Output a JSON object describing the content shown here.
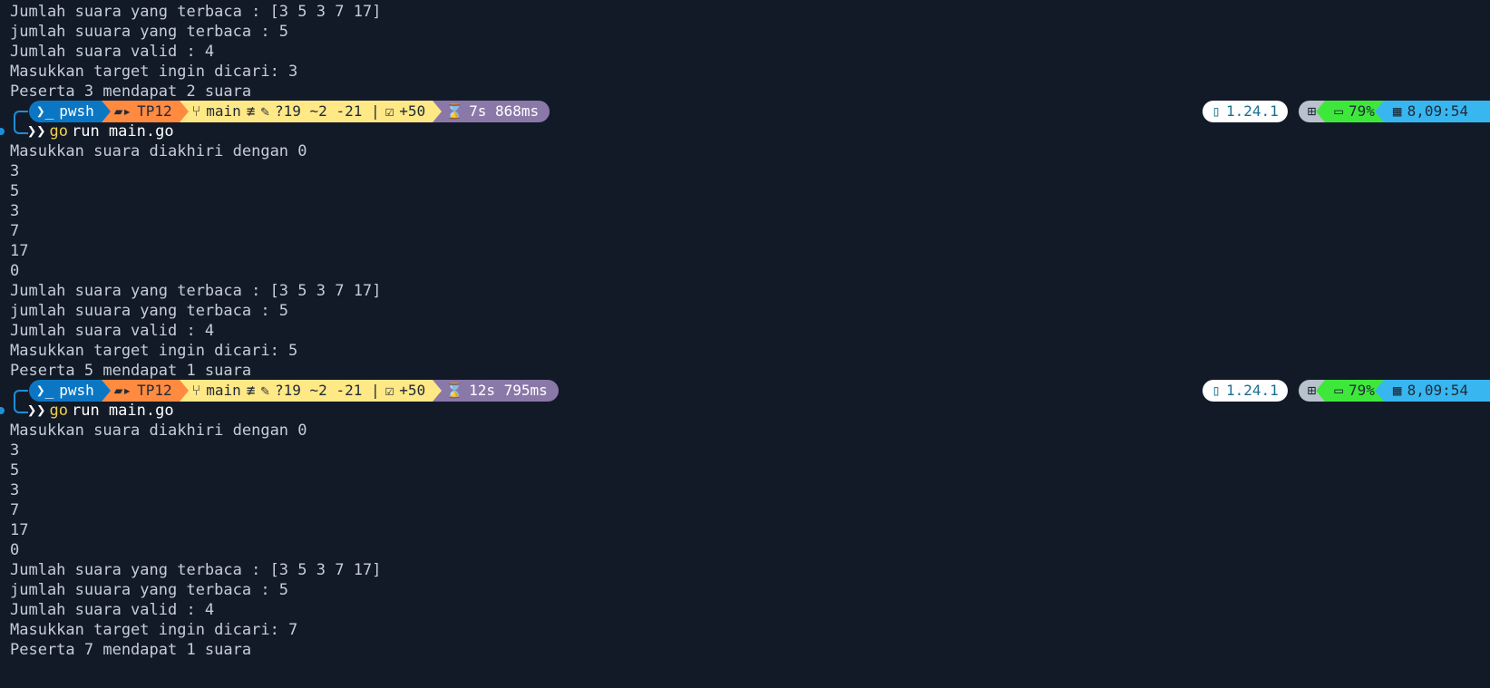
{
  "colors": {
    "background": "#121a28",
    "text": "#c7cdd6",
    "shell_segment": "#0b77c4",
    "path_segment": "#ff8a40",
    "git_segment": "#ffe886",
    "time_segment": "#8a78a8",
    "go_version_segment": "#ffffff",
    "os_segment": "#b8c2cc",
    "battery_segment": "#3ee83a",
    "date_segment": "#38b6f0"
  },
  "top_output": [
    "Jumlah suara yang terbaca : [3 5 3 7 17]",
    "jumlah suuara yang terbaca : 5",
    "Jumlah suara valid : 4",
    "Masukkan target ingin dicari: 3",
    "Peserta 3 mendapat 2 suara"
  ],
  "prompts": [
    {
      "shell": "pwsh",
      "folder": "TP12",
      "branch": "main",
      "branch_status": "≢",
      "changes": "?19 ~2 -21 |",
      "staged": "+50",
      "duration": "7s 868ms",
      "go_version": "1.24.1",
      "battery": "79%",
      "datetime": "8,09:54",
      "command_tool": "go",
      "command_args": "run main.go",
      "output": [
        "Masukkan suara diakhiri dengan 0",
        "3",
        "5",
        "3",
        "7",
        "17",
        "0",
        "Jumlah suara yang terbaca : [3 5 3 7 17]",
        "jumlah suuara yang terbaca : 5",
        "Jumlah suara valid : 4",
        "Masukkan target ingin dicari: 5",
        "Peserta 5 mendapat 1 suara"
      ]
    },
    {
      "shell": "pwsh",
      "folder": "TP12",
      "branch": "main",
      "branch_status": "≢",
      "changes": "?19 ~2 -21 |",
      "staged": "+50",
      "duration": "12s 795ms",
      "go_version": "1.24.1",
      "battery": "79%",
      "datetime": "8,09:54",
      "command_tool": "go",
      "command_args": "run main.go",
      "output": [
        "Masukkan suara diakhiri dengan 0",
        "3",
        "5",
        "3",
        "7",
        "17",
        "0",
        "Jumlah suara yang terbaca : [3 5 3 7 17]",
        "jumlah suuara yang terbaca : 5",
        "Jumlah suara valid : 4",
        "Masukkan target ingin dicari: 7",
        "Peserta 7 mendapat 1 suara"
      ]
    }
  ]
}
